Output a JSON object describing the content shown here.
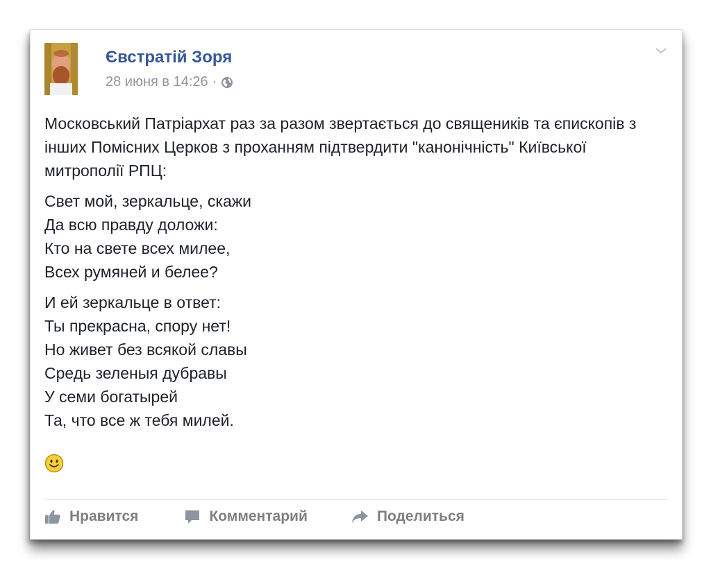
{
  "post": {
    "author": "Євстратій Зоря",
    "timestamp": "28 июня в 14:26",
    "separator": "·",
    "paragraphs": [
      "Московський Патріархат раз за разом звертається до священиків та єпископів з інших Помісних Церков з проханням підтвердити \"канонічність\" Київської митрополії РПЦ:",
      "Свет мой, зеркальце, скажи\nДа всю правду доложи:\nКто на свете всех милее,\nВсех румяней и белее?",
      "И ей зеркальце в ответ:\nТы прекрасна, спору нет!\nНо живет без всякой славы\nСредь зеленыя дубравы\nУ семи богатырей\nТа, что все ж тебя милей."
    ],
    "emoji_icon": "smiley-icon"
  },
  "actions": {
    "like_label": "Нравится",
    "comment_label": "Комментарий",
    "share_label": "Поделиться"
  },
  "colors": {
    "author_link": "#365899",
    "meta_text": "#90949c",
    "body_text": "#1d2129",
    "action_text": "#7f7f7f"
  }
}
